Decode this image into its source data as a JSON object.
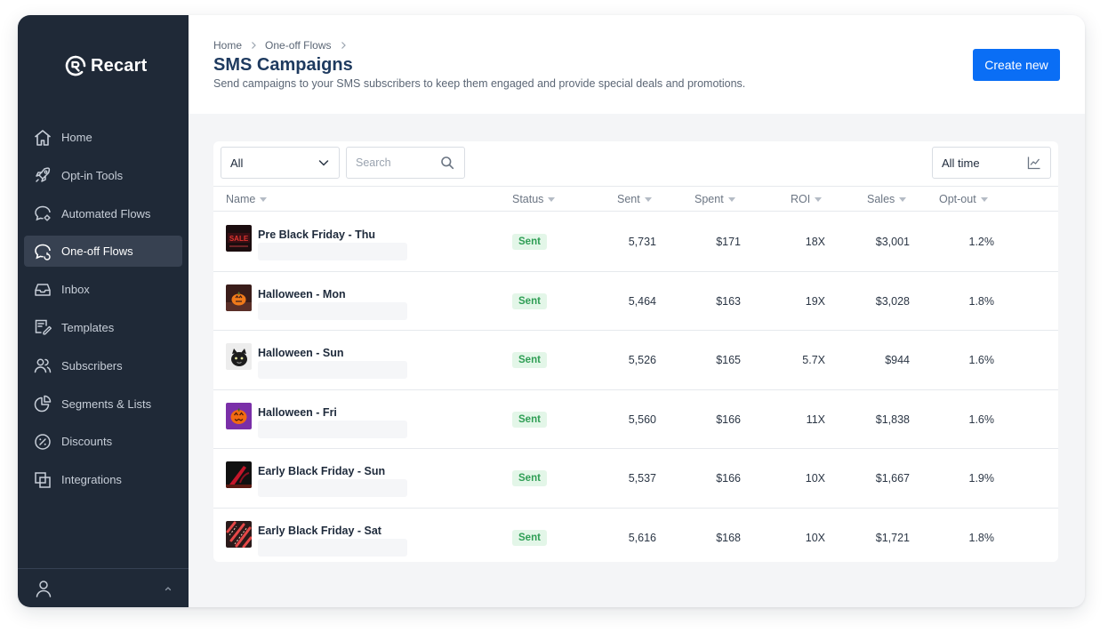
{
  "brand": {
    "name": "Recart"
  },
  "sidebar": {
    "items": [
      {
        "label": "Home",
        "icon": "home-icon",
        "active": false
      },
      {
        "label": "Opt-in Tools",
        "icon": "rocket-icon",
        "active": false
      },
      {
        "label": "Automated Flows",
        "icon": "chat-gear-icon",
        "active": false
      },
      {
        "label": "One-off Flows",
        "icon": "chat-refresh-icon",
        "active": true
      },
      {
        "label": "Inbox",
        "icon": "inbox-icon",
        "active": false
      },
      {
        "label": "Templates",
        "icon": "template-pen-icon",
        "active": false
      },
      {
        "label": "Subscribers",
        "icon": "users-icon",
        "active": false
      },
      {
        "label": "Segments & Lists",
        "icon": "pie-chart-icon",
        "active": false
      },
      {
        "label": "Discounts",
        "icon": "percent-icon",
        "active": false
      },
      {
        "label": "Integrations",
        "icon": "layers-icon",
        "active": false
      }
    ]
  },
  "header": {
    "breadcrumb": [
      "Home",
      "One-off Flows"
    ],
    "title": "SMS Campaigns",
    "subtitle": "Send campaigns to your SMS subscribers to keep them engaged and provide special deals and promotions.",
    "create_label": "Create new"
  },
  "toolbar": {
    "filter_value": "All",
    "search_placeholder": "Search",
    "time_value": "All time"
  },
  "table": {
    "columns": [
      "Name",
      "Status",
      "Sent",
      "Spent",
      "ROI",
      "Sales",
      "Opt-out"
    ],
    "rows": [
      {
        "name": "Pre Black Friday - Thu",
        "status": "Sent",
        "sent": "5,731",
        "spent": "$171",
        "roi": "18X",
        "sales": "$3,001",
        "optout": "1.2%"
      },
      {
        "name": "Halloween - Mon",
        "status": "Sent",
        "sent": "5,464",
        "spent": "$163",
        "roi": "19X",
        "sales": "$3,028",
        "optout": "1.8%"
      },
      {
        "name": "Halloween - Sun",
        "status": "Sent",
        "sent": "5,526",
        "spent": "$165",
        "roi": "5.7X",
        "sales": "$944",
        "optout": "1.6%"
      },
      {
        "name": "Halloween - Fri",
        "status": "Sent",
        "sent": "5,560",
        "spent": "$166",
        "roi": "11X",
        "sales": "$1,838",
        "optout": "1.6%"
      },
      {
        "name": "Early Black Friday - Sun",
        "status": "Sent",
        "sent": "5,537",
        "spent": "$166",
        "roi": "10X",
        "sales": "$1,667",
        "optout": "1.9%"
      },
      {
        "name": "Early Black Friday - Sat",
        "status": "Sent",
        "sent": "5,616",
        "spent": "$168",
        "roi": "10X",
        "sales": "$1,721",
        "optout": "1.8%"
      }
    ]
  },
  "colors": {
    "sidebar_bg": "#1f2937",
    "accent": "#0a6ef5",
    "status_sent_bg": "#e3f6e8",
    "status_sent_text": "#2f9e55"
  }
}
